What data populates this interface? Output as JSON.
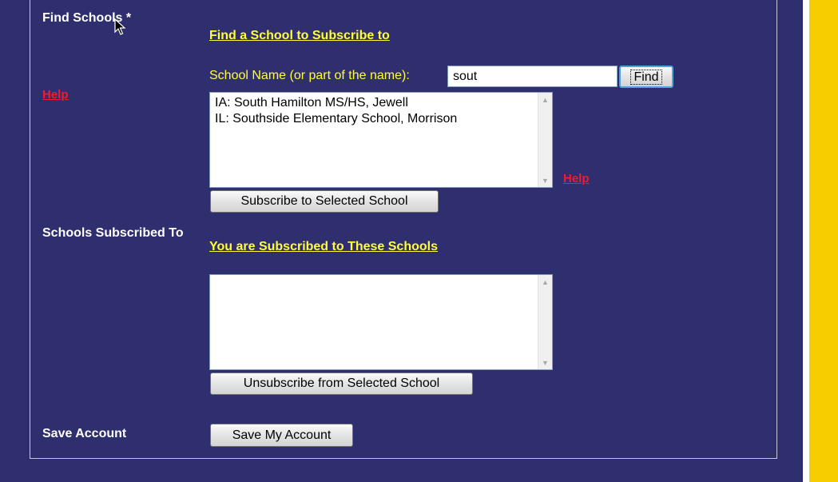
{
  "find_section": {
    "label": "Find Schools *",
    "title": "Find a School to Subscribe to",
    "help": "Help",
    "school_name_label": "School Name (or part of the name):",
    "search_value": "sout",
    "find_button": "Find",
    "results": [
      "IA: South Hamilton MS/HS, Jewell",
      "IL: Southside Elementary School, Morrison"
    ],
    "results_help": "Help",
    "subscribe_button": "Subscribe to Selected School"
  },
  "subscribed_section": {
    "label": "Schools Subscribed To",
    "title": "You are Subscribed to These Schools",
    "items": [],
    "unsubscribe_button": "Unsubscribe from Selected School"
  },
  "save_section": {
    "label": "Save Account",
    "save_button": "Save My Account"
  },
  "colors": {
    "background": "#2f2f6f",
    "accent_text": "#ffff33",
    "link": "#ee1c2d",
    "side_stripe": "#f7cd00"
  }
}
